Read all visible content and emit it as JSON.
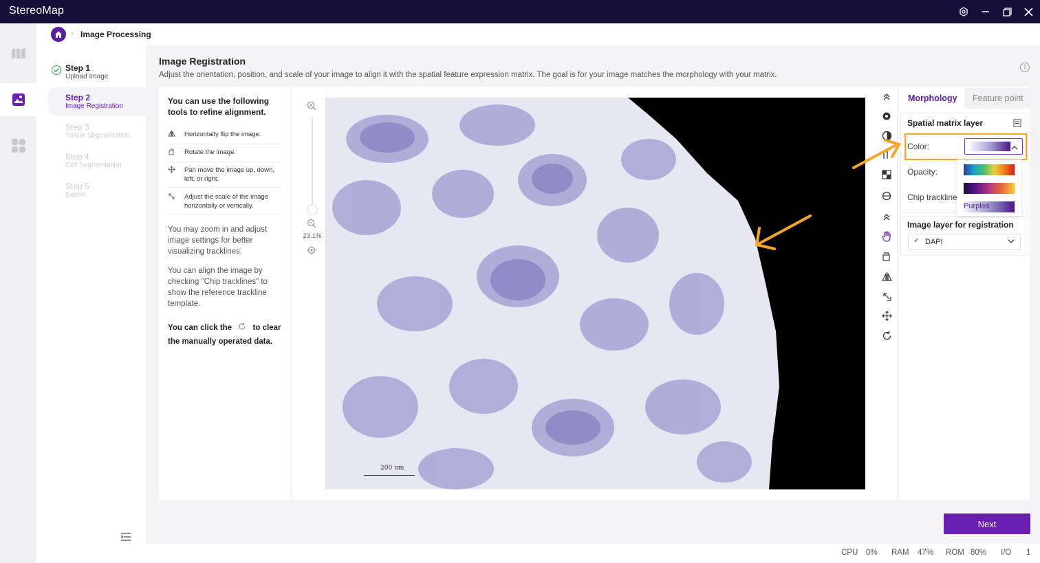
{
  "app": {
    "title": "StereoMap"
  },
  "breadcrumb": {
    "title": "Image Processing"
  },
  "steps": [
    {
      "title": "Step 1",
      "sub": "Upload Image",
      "state": "done"
    },
    {
      "title": "Step 2",
      "sub": "Image Registration",
      "state": "active"
    },
    {
      "title": "Step 3",
      "sub": "Tissue Segmentation",
      "state": "disabled"
    },
    {
      "title": "Step 4",
      "sub": "Cell Segmentation",
      "state": "disabled"
    },
    {
      "title": "Step 5",
      "sub": "Export",
      "state": "disabled"
    }
  ],
  "main": {
    "title": "Image Registration",
    "description": "Adjust the orientation, position, and scale of your image to align it with the spatial feature expression matrix. The goal is for your image matches the morphology with your matrix."
  },
  "tips": {
    "heading": "You can use the following tools to refine alignment.",
    "items": [
      {
        "icon": "flip-icon",
        "text": "Horizontally flip the image."
      },
      {
        "icon": "rotate-icon",
        "text": "Rotate the image."
      },
      {
        "icon": "pan-icon",
        "text": "Pan move the image up, down, left, or right."
      },
      {
        "icon": "scale-icon",
        "text": "Adjust the scale of the image horizontally or vertically."
      }
    ],
    "para1": "You may zoom in and adjust image settings for better visualizing tracklines.",
    "para2": "You can align the image by checking \"Chip tracklines\" to show the reference trackline template.",
    "bold_pre": "You can click the",
    "bold_post": "to clear the manually operated data."
  },
  "zoom": {
    "percent": "23.1%"
  },
  "canvas": {
    "scalebar": "200 um"
  },
  "rpanel": {
    "tabs": {
      "morphology": "Morphology",
      "feature": "Feature point"
    },
    "spatial_layer": "Spatial matrix layer",
    "color_label": "Color:",
    "opacity_label": "Opacity:",
    "chip_label": "Chip trackline",
    "colormaps": [
      "",
      "",
      "Purples"
    ],
    "image_layer": "Image layer for registration",
    "image_layer_value": "DAPI"
  },
  "actions": {
    "next": "Next"
  },
  "status": {
    "cpu_label": "CPU",
    "cpu": "0%",
    "ram_label": "RAM",
    "ram": "47%",
    "rom_label": "ROM",
    "rom": "80%",
    "io_label": "I/O",
    "io": "1"
  },
  "colors": {
    "accent": "#6a1fb3",
    "titlebar": "#160f3a",
    "annotation": "#f5a623"
  }
}
